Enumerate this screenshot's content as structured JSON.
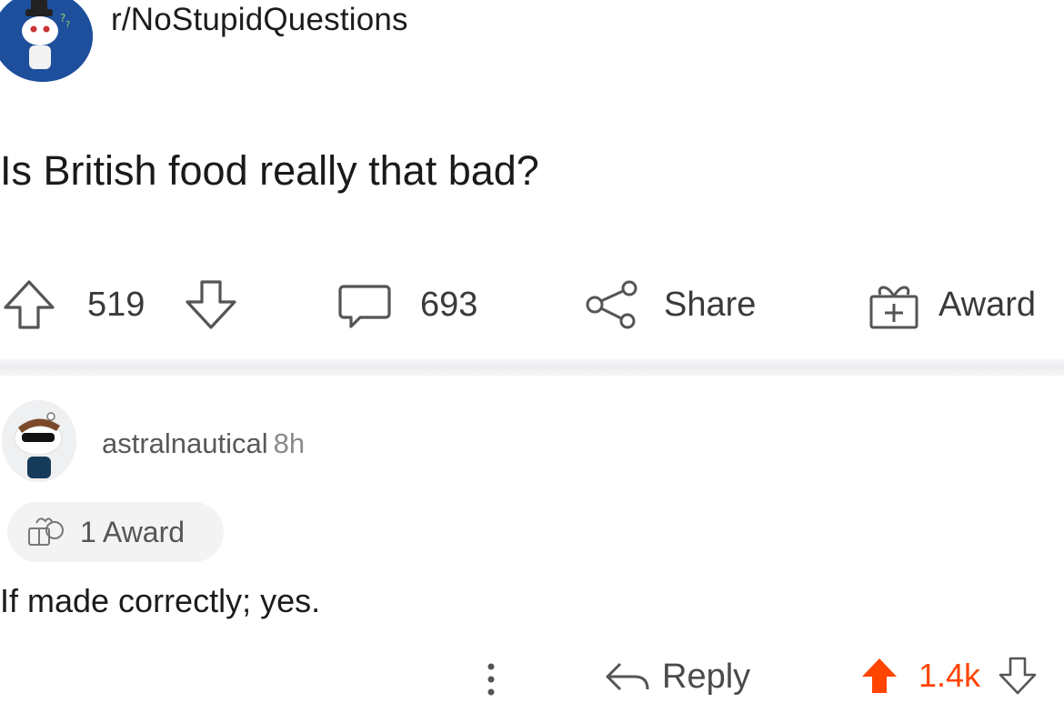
{
  "subreddit": {
    "name": "r/NoStupidQuestions"
  },
  "post": {
    "title": "Is British food really that bad?",
    "upvotes": "519",
    "comments": "693",
    "share_label": "Share",
    "award_label": "Award"
  },
  "comment": {
    "username": "astralnautical",
    "age": "8h",
    "award_text": "1 Award",
    "body": "If made correctly; yes.",
    "reply_label": "Reply",
    "score": "1.4k"
  },
  "colors": {
    "upvote_active": "#ff4500",
    "subreddit_avatar_bg": "#1e4f9c"
  }
}
